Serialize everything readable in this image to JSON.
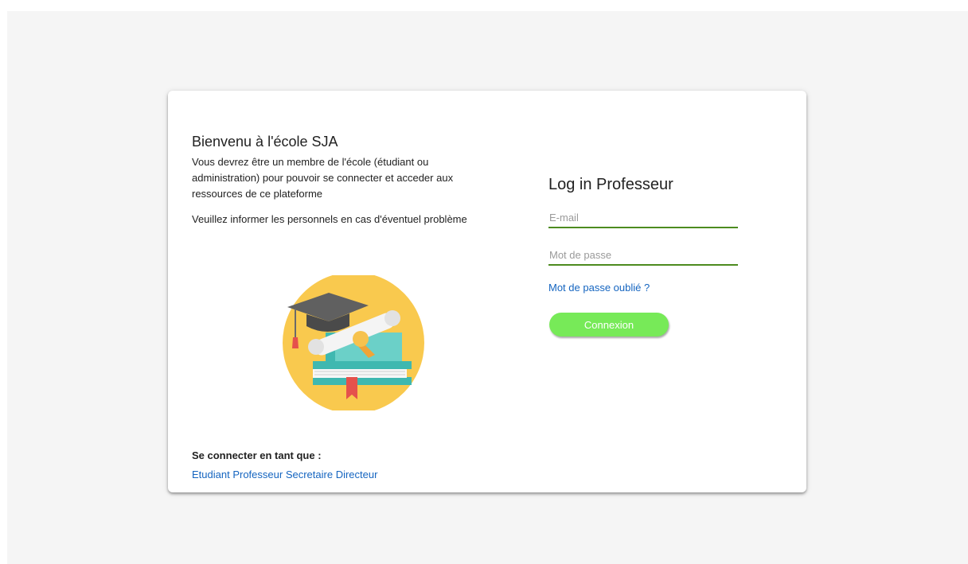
{
  "welcome": {
    "title": "Bienvenu à l'école SJA",
    "text": "Vous devrez être un membre de l'école (étudiant ou administration) pour pouvoir se connecter et acceder aux ressources de ce plateforme",
    "note": "Veuillez informer les personnels en cas d'éventuel problème",
    "illustration": "graduation-books-icon"
  },
  "footer": {
    "label": "Se connecter en tant que :",
    "roles": [
      "Etudiant",
      "Professeur",
      "Secretaire",
      "Directeur"
    ]
  },
  "login": {
    "title": "Log in Professeur",
    "email_placeholder": "E-mail",
    "email_value": "",
    "password_placeholder": "Mot de passe",
    "password_value": "",
    "forgot_label": "Mot de passe oublié ?",
    "submit_label": "Connexion"
  },
  "colors": {
    "accent_green": "#77ea58",
    "field_underline": "#4d8b1f",
    "link_blue": "#1565c0",
    "page_bg": "#f5f5f5"
  }
}
